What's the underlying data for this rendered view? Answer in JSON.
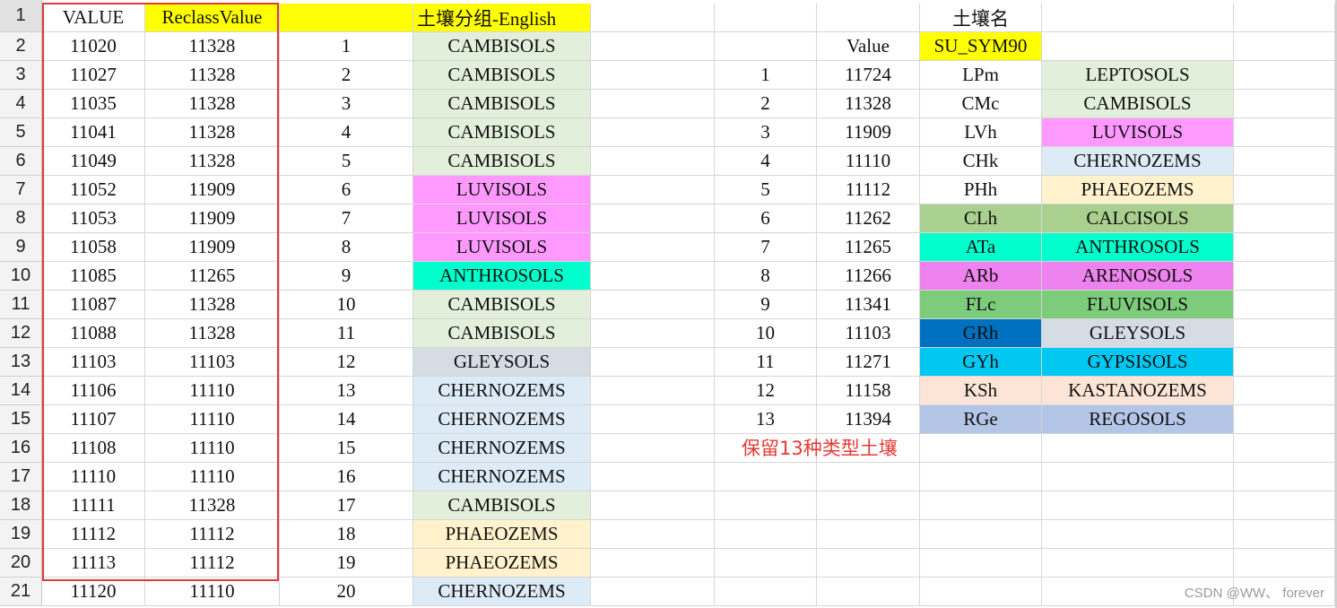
{
  "sheet": {
    "row_numbers": [
      "1",
      "2",
      "3",
      "4",
      "5",
      "6",
      "7",
      "8",
      "9",
      "10",
      "11",
      "12",
      "13",
      "14",
      "15",
      "16",
      "17",
      "18",
      "19",
      "20",
      "21"
    ],
    "colors": {
      "yellow": "#ffff00",
      "cambisols": "#e2efda",
      "luvisols": "#ff99ff",
      "anthrosols": "#00ffcc",
      "gleysols": "#d6dce4",
      "chernozems": "#ddebf7",
      "phaeozems": "#fff2cc",
      "leptosols": "#e2efda",
      "calcisols": "#a9d08e",
      "arenosols": "#ee82ee",
      "fluvisols": "#7ccc7c",
      "gleysols_code": "#0070c0",
      "gypsisols": "#00c8f0",
      "kastanozems": "#fce4d6",
      "regosols": "#b4c6e7",
      "red_box": "#e53935"
    },
    "left_table": {
      "header_value": "VALUE",
      "header_reclass": "ReclassValue",
      "header_group": "土壤分组-English",
      "rows": [
        {
          "value": "11020",
          "reclass": "11328",
          "idx": "1",
          "name": "CAMBISOLS",
          "color": "#e2efda"
        },
        {
          "value": "11027",
          "reclass": "11328",
          "idx": "2",
          "name": "CAMBISOLS",
          "color": "#e2efda"
        },
        {
          "value": "11035",
          "reclass": "11328",
          "idx": "3",
          "name": "CAMBISOLS",
          "color": "#e2efda"
        },
        {
          "value": "11041",
          "reclass": "11328",
          "idx": "4",
          "name": "CAMBISOLS",
          "color": "#e2efda"
        },
        {
          "value": "11049",
          "reclass": "11328",
          "idx": "5",
          "name": "CAMBISOLS",
          "color": "#e2efda"
        },
        {
          "value": "11052",
          "reclass": "11909",
          "idx": "6",
          "name": "LUVISOLS",
          "color": "#ff99ff"
        },
        {
          "value": "11053",
          "reclass": "11909",
          "idx": "7",
          "name": "LUVISOLS",
          "color": "#ff99ff"
        },
        {
          "value": "11058",
          "reclass": "11909",
          "idx": "8",
          "name": "LUVISOLS",
          "color": "#ff99ff"
        },
        {
          "value": "11085",
          "reclass": "11265",
          "idx": "9",
          "name": "ANTHROSOLS",
          "color": "#00ffcc"
        },
        {
          "value": "11087",
          "reclass": "11328",
          "idx": "10",
          "name": "CAMBISOLS",
          "color": "#e2efda"
        },
        {
          "value": "11088",
          "reclass": "11328",
          "idx": "11",
          "name": "CAMBISOLS",
          "color": "#e2efda"
        },
        {
          "value": "11103",
          "reclass": "11103",
          "idx": "12",
          "name": "GLEYSOLS",
          "color": "#d6dce4"
        },
        {
          "value": "11106",
          "reclass": "11110",
          "idx": "13",
          "name": "CHERNOZEMS",
          "color": "#ddebf7"
        },
        {
          "value": "11107",
          "reclass": "11110",
          "idx": "14",
          "name": "CHERNOZEMS",
          "color": "#ddebf7"
        },
        {
          "value": "11108",
          "reclass": "11110",
          "idx": "15",
          "name": "CHERNOZEMS",
          "color": "#ddebf7"
        },
        {
          "value": "11110",
          "reclass": "11110",
          "idx": "16",
          "name": "CHERNOZEMS",
          "color": "#ddebf7"
        },
        {
          "value": "11111",
          "reclass": "11328",
          "idx": "17",
          "name": "CAMBISOLS",
          "color": "#e2efda"
        },
        {
          "value": "11112",
          "reclass": "11112",
          "idx": "18",
          "name": "PHAEOZEMS",
          "color": "#fff2cc"
        },
        {
          "value": "11113",
          "reclass": "11112",
          "idx": "19",
          "name": "PHAEOZEMS",
          "color": "#fff2cc"
        },
        {
          "value": "11120",
          "reclass": "11110",
          "idx": "20",
          "name": "CHERNOZEMS",
          "color": "#ddebf7"
        }
      ]
    },
    "right_table": {
      "title": "土壤名",
      "header_value": "Value",
      "header_sym": "SU_SYM90",
      "rows": [
        {
          "idx": "1",
          "value": "11724",
          "code": "LPm",
          "code_color": "",
          "name": "LEPTOSOLS",
          "name_color": "#e2efda"
        },
        {
          "idx": "2",
          "value": "11328",
          "code": "CMc",
          "code_color": "",
          "name": "CAMBISOLS",
          "name_color": "#e2efda"
        },
        {
          "idx": "3",
          "value": "11909",
          "code": "LVh",
          "code_color": "",
          "name": "LUVISOLS",
          "name_color": "#ff99ff"
        },
        {
          "idx": "4",
          "value": "11110",
          "code": "CHk",
          "code_color": "",
          "name": "CHERNOZEMS",
          "name_color": "#ddebf7"
        },
        {
          "idx": "5",
          "value": "11112",
          "code": "PHh",
          "code_color": "",
          "name": "PHAEOZEMS",
          "name_color": "#fff2cc"
        },
        {
          "idx": "6",
          "value": "11262",
          "code": "CLh",
          "code_color": "#a9d08e",
          "name": "CALCISOLS",
          "name_color": "#a9d08e"
        },
        {
          "idx": "7",
          "value": "11265",
          "code": "ATa",
          "code_color": "#00ffcc",
          "name": "ANTHROSOLS",
          "name_color": "#00ffcc"
        },
        {
          "idx": "8",
          "value": "11266",
          "code": "ARb",
          "code_color": "#ee82ee",
          "name": "ARENOSOLS",
          "name_color": "#ee82ee"
        },
        {
          "idx": "9",
          "value": "11341",
          "code": "FLc",
          "code_color": "#7ccc7c",
          "name": "FLUVISOLS",
          "name_color": "#7ccc7c"
        },
        {
          "idx": "10",
          "value": "11103",
          "code": "GRh",
          "code_color": "#0070c0",
          "name": "GLEYSOLS",
          "name_color": "#d6dce4"
        },
        {
          "idx": "11",
          "value": "11271",
          "code": "GYh",
          "code_color": "#00c8f0",
          "name": "GYPSISOLS",
          "name_color": "#00c8f0"
        },
        {
          "idx": "12",
          "value": "11158",
          "code": "KSh",
          "code_color": "#fce4d6",
          "name": "KASTANOZEMS",
          "name_color": "#fce4d6"
        },
        {
          "idx": "13",
          "value": "11394",
          "code": "RGe",
          "code_color": "#b4c6e7",
          "name": "REGOSOLS",
          "name_color": "#b4c6e7"
        }
      ]
    },
    "note": "保留13种类型土壤",
    "watermark": "CSDN @WW、 forever"
  }
}
